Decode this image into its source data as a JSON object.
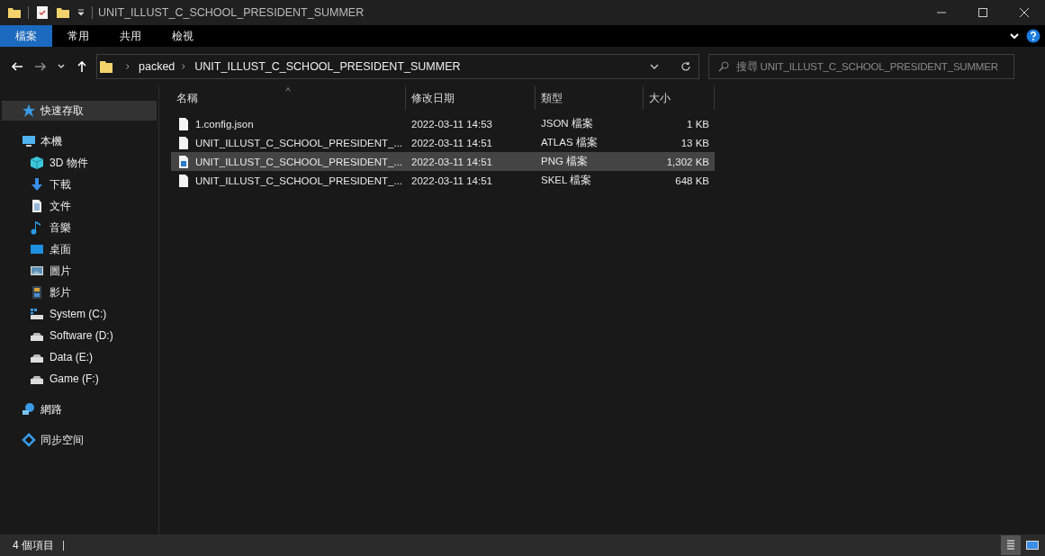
{
  "window": {
    "title": "UNIT_ILLUST_C_SCHOOL_PRESIDENT_SUMMER"
  },
  "ribbon_tabs": [
    {
      "label": "檔案",
      "selected": true
    },
    {
      "label": "常用",
      "selected": false
    },
    {
      "label": "共用",
      "selected": false
    },
    {
      "label": "檢視",
      "selected": false
    }
  ],
  "address_bar": {
    "path": [
      "packed",
      "UNIT_ILLUST_C_SCHOOL_PRESIDENT_SUMMER"
    ]
  },
  "search": {
    "placeholder": "搜尋 UNIT_ILLUST_C_SCHOOL_PRESIDENT_SUMMER"
  },
  "sidebar": {
    "items": [
      {
        "label": "快速存取",
        "kind": "star",
        "selected": true
      },
      {
        "label": "本機",
        "kind": "pc",
        "selected": false,
        "children": [
          {
            "label": "3D 物件",
            "kind": "cube",
            "selected": false
          },
          {
            "label": "下載",
            "kind": "download",
            "selected": false
          },
          {
            "label": "文件",
            "kind": "document",
            "selected": false
          },
          {
            "label": "音樂",
            "kind": "music",
            "selected": false
          },
          {
            "label": "桌面",
            "kind": "desktop",
            "selected": false
          },
          {
            "label": "圖片",
            "kind": "picture",
            "selected": false
          },
          {
            "label": "影片",
            "kind": "video",
            "selected": false
          },
          {
            "label": "System (C:)",
            "kind": "system-drive",
            "selected": false
          },
          {
            "label": "Software (D:)",
            "kind": "drive",
            "selected": false
          },
          {
            "label": "Data (E:)",
            "kind": "drive",
            "selected": false
          },
          {
            "label": "Game (F:)",
            "kind": "drive",
            "selected": false
          }
        ]
      },
      {
        "label": "網路",
        "kind": "network",
        "selected": false
      },
      {
        "label": "同步空间",
        "kind": "sync",
        "selected": false
      }
    ]
  },
  "table": {
    "columns": [
      {
        "label": "名稱",
        "sorted": true
      },
      {
        "label": "修改日期",
        "sorted": false
      },
      {
        "label": "類型",
        "sorted": false
      },
      {
        "label": "大小",
        "sorted": false
      }
    ],
    "rows": [
      {
        "kind": "file",
        "name": "1.config.json",
        "date": "2022-03-11 14:53",
        "type": "JSON 檔案",
        "size": "1 KB",
        "selected": false
      },
      {
        "kind": "file",
        "name": "UNIT_ILLUST_C_SCHOOL_PRESIDENT_...",
        "date": "2022-03-11 14:51",
        "type": "ATLAS 檔案",
        "size": "13 KB",
        "selected": false
      },
      {
        "kind": "image",
        "name": "UNIT_ILLUST_C_SCHOOL_PRESIDENT_...",
        "date": "2022-03-11 14:51",
        "type": "PNG 檔案",
        "size": "1,302 KB",
        "selected": true
      },
      {
        "kind": "file",
        "name": "UNIT_ILLUST_C_SCHOOL_PRESIDENT_...",
        "date": "2022-03-11 14:51",
        "type": "SKEL 檔案",
        "size": "648 KB",
        "selected": false
      }
    ]
  },
  "status_bar": {
    "count": "4 個項目",
    "view_buttons": [
      {
        "kind": "details",
        "selected": true
      },
      {
        "kind": "thumbnails",
        "selected": false
      }
    ]
  }
}
